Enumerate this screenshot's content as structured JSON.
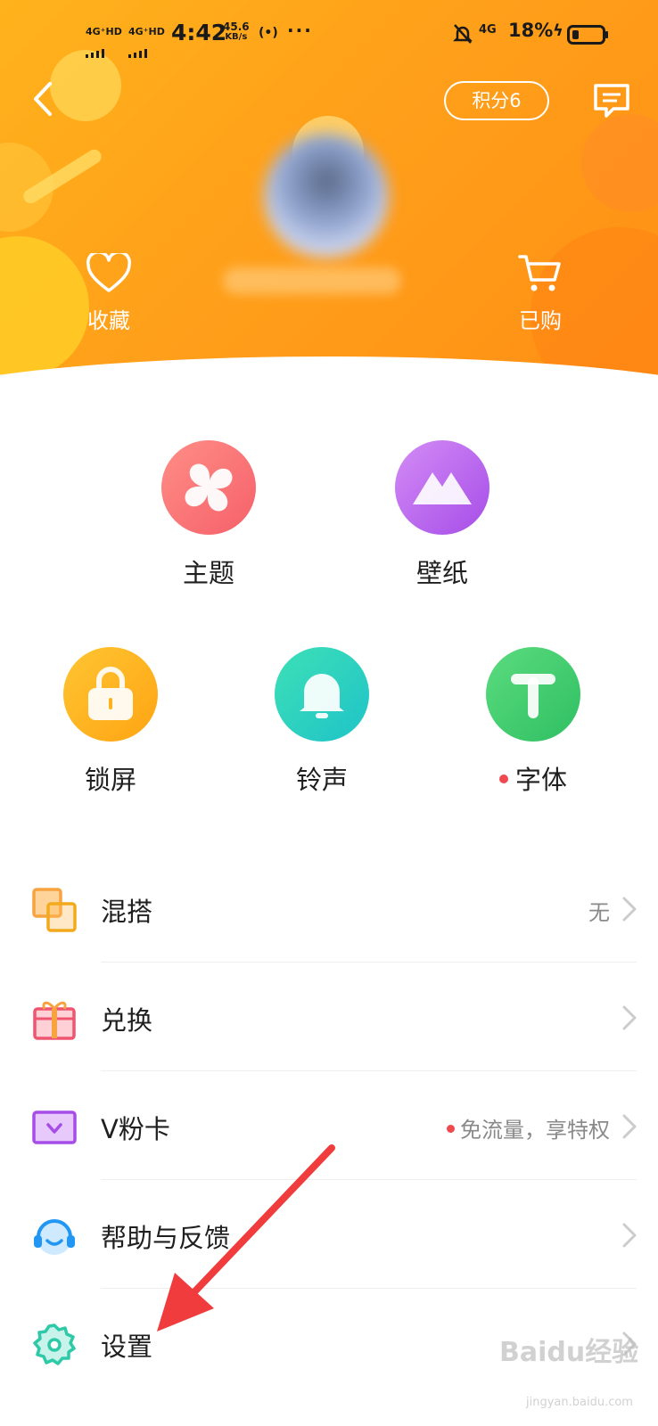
{
  "status_bar": {
    "sig1": "4G⁺HD",
    "sig2": "4G⁺HD",
    "time": "4:42",
    "speed_value": "45.6",
    "speed_unit": "KB/s",
    "net": "4G",
    "battery_percent": "18%"
  },
  "header": {
    "points_label": "积分6",
    "actions": [
      {
        "label": "收藏",
        "icon": "heart-icon"
      },
      {
        "label": "已购",
        "icon": "cart-icon"
      }
    ]
  },
  "grid": [
    {
      "label": "主题",
      "icon": "pinwheel-icon"
    },
    {
      "label": "壁纸",
      "icon": "mountain-icon"
    },
    {
      "label": "锁屏",
      "icon": "lock-icon"
    },
    {
      "label": "铃声",
      "icon": "bell-icon"
    },
    {
      "label": "字体",
      "icon": "font-t-icon",
      "badge": true
    }
  ],
  "list": [
    {
      "label": "混搭",
      "value": "无",
      "icon": "mix-icon"
    },
    {
      "label": "兑换",
      "value": "",
      "icon": "gift-icon"
    },
    {
      "label": "V粉卡",
      "value": "免流量，享特权",
      "icon": "vcard-icon",
      "badge": true
    },
    {
      "label": "帮助与反馈",
      "value": "",
      "icon": "headset-icon"
    },
    {
      "label": "设置",
      "value": "",
      "icon": "settings-gear-icon"
    }
  ],
  "watermark": {
    "text": "Baidu经验",
    "sub": "jingyan.baidu.com"
  },
  "colors": {
    "header_orange": "#ffa01a",
    "theme_pink": "#f96f6f",
    "wallpaper_purple": "#b35cf0",
    "lock_yellow": "#ffb21c",
    "ring_teal": "#2fd0b8",
    "font_green": "#3fce6f",
    "badge_red": "#f0494f"
  }
}
